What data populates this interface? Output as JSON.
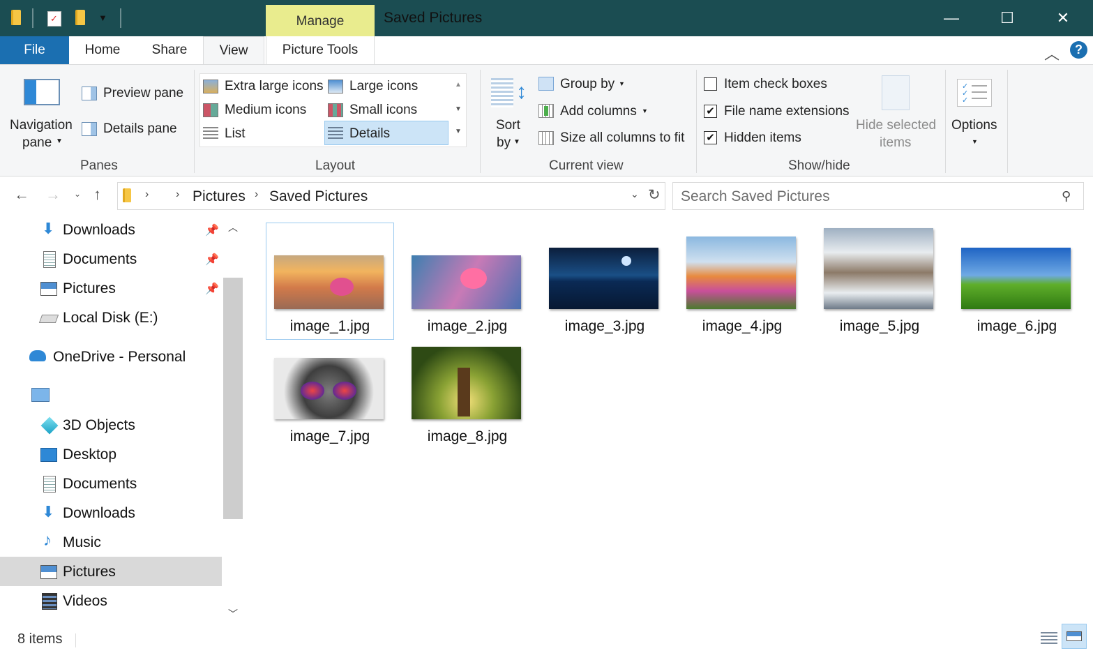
{
  "titlebar": {
    "manage_tab": "Manage",
    "window_title": "Saved Pictures",
    "minimize": "—",
    "maximize": "☐",
    "close": "✕"
  },
  "ribbon_tabs": {
    "file": "File",
    "home": "Home",
    "share": "Share",
    "view": "View",
    "picture_tools": "Picture Tools"
  },
  "panes": {
    "navigation_pane_line1": "Navigation",
    "navigation_pane_line2": "pane",
    "preview_pane": "Preview pane",
    "details_pane": "Details pane",
    "group_label": "Panes"
  },
  "layout": {
    "extra_large_icons": "Extra large icons",
    "large_icons": "Large icons",
    "medium_icons": "Medium icons",
    "small_icons": "Small icons",
    "list": "List",
    "details": "Details",
    "group_label": "Layout"
  },
  "current_view": {
    "sort_line1": "Sort",
    "sort_line2": "by",
    "group_by": "Group by",
    "add_columns": "Add columns",
    "size_all_columns": "Size all columns to fit",
    "group_label": "Current view"
  },
  "show_hide": {
    "item_check_boxes": "Item check boxes",
    "file_name_extensions": "File name extensions",
    "hidden_items": "Hidden items",
    "hide_selected_line1": "Hide selected",
    "hide_selected_line2": "items",
    "group_label": "Show/hide",
    "item_check_boxes_checked": false,
    "file_name_extensions_checked": true,
    "hidden_items_checked": true
  },
  "options": {
    "label": "Options"
  },
  "address": {
    "crumb1": "Pictures",
    "crumb2": "Saved Pictures",
    "search_placeholder": "Search Saved Pictures"
  },
  "sidebar": {
    "quick_access": [
      "Downloads",
      "Documents",
      "Pictures"
    ],
    "local_disk": "Local Disk (E:)",
    "onedrive": "OneDrive - Personal",
    "this_pc_items": [
      "3D Objects",
      "Desktop",
      "Documents",
      "Downloads",
      "Music",
      "Pictures",
      "Videos"
    ]
  },
  "files": [
    "image_1.jpg",
    "image_2.jpg",
    "image_3.jpg",
    "image_4.jpg",
    "image_5.jpg",
    "image_6.jpg",
    "image_7.jpg",
    "image_8.jpg"
  ],
  "status": {
    "item_count": "8 items"
  },
  "colors": {
    "titlebar": "#1b4d52",
    "manage_tab": "#e9ec8e",
    "file_tab": "#1b6fb1",
    "selection": "#cce4f7"
  }
}
